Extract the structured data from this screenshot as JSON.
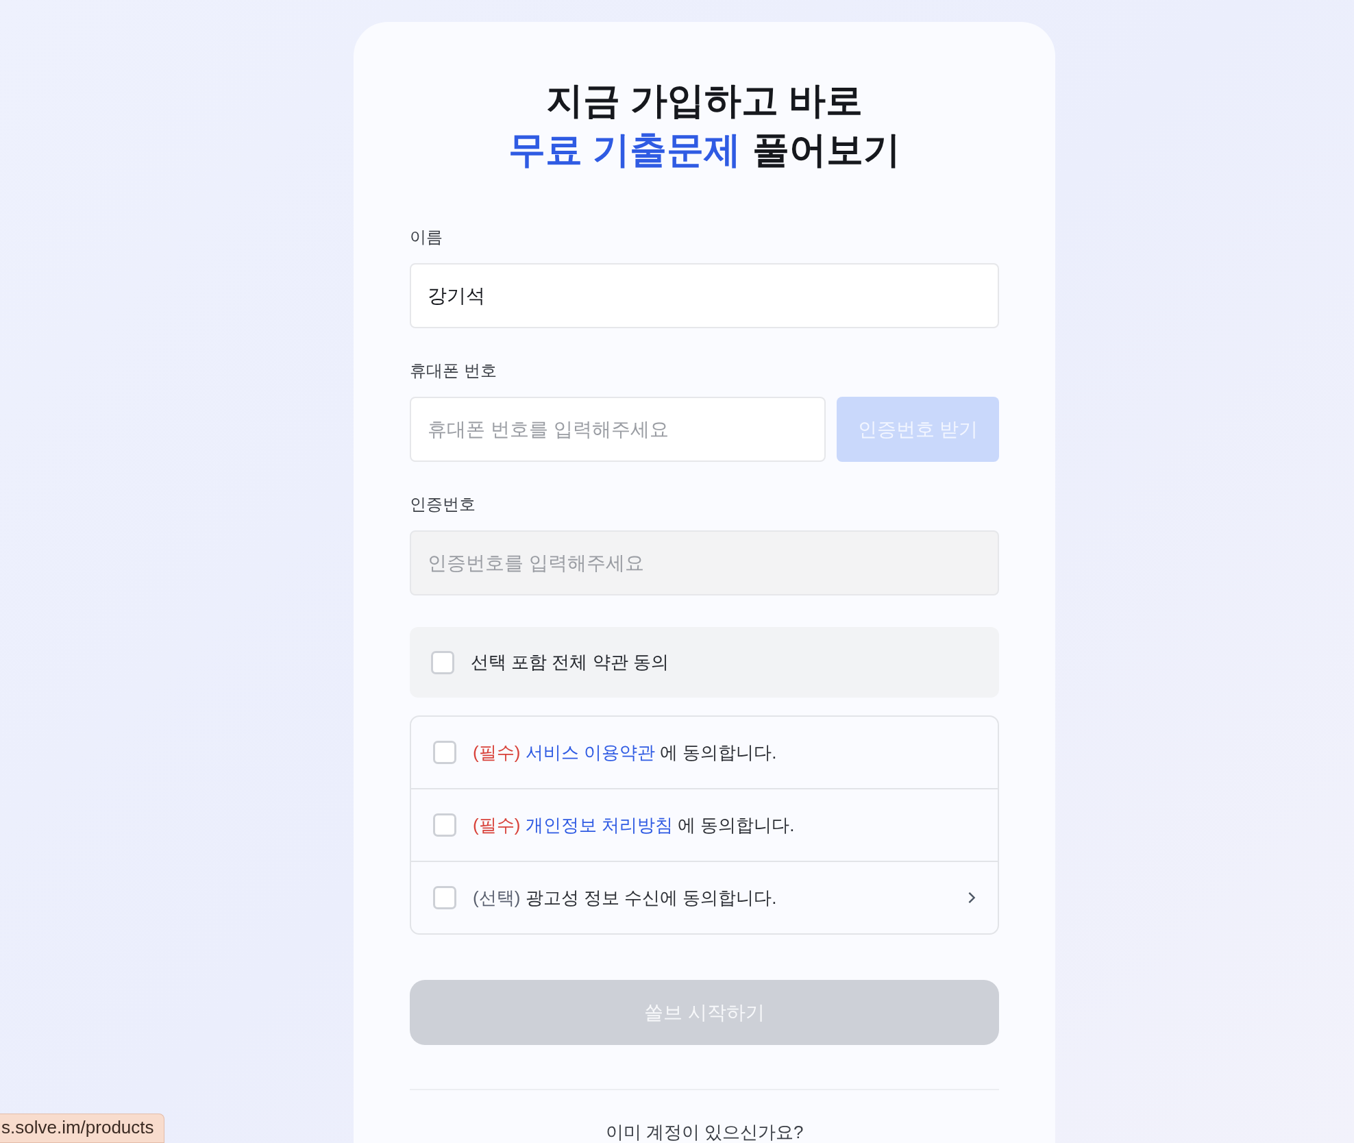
{
  "title": {
    "lines": [
      [
        {
          "text": "지금 가입하고 바로",
          "emphasis": false
        }
      ],
      [
        {
          "text": "무료 기출문제",
          "emphasis": true
        },
        {
          "text": "풀어보기",
          "emphasis": false
        }
      ]
    ]
  },
  "fields": [
    {
      "label": "이름",
      "value": "강기석",
      "disabled": false
    },
    {
      "label": "휴대폰 번호",
      "placeholder": "휴대폰 번호를 입력해주세요",
      "disabled": false,
      "button": {
        "label": "인증번호 받기",
        "disabled": true
      }
    },
    {
      "label": "인증번호",
      "placeholder": "인증번호를 입력해주세요",
      "disabled": true
    }
  ],
  "agree_all": {
    "label": "선택 포함 전체 약관 동의",
    "checked": false
  },
  "agreements": [
    {
      "tag": "(필수)",
      "required": true,
      "link": "서비스 이용약관",
      "text": "에 동의합니다.",
      "checked": false,
      "chevron": false
    },
    {
      "tag": "(필수)",
      "required": true,
      "link": "개인정보 처리방침",
      "text": "에 동의합니다.",
      "checked": false,
      "chevron": false
    },
    {
      "tag": "(선택)",
      "required": false,
      "text": "광고성 정보 수신에 동의합니다.",
      "checked": false,
      "chevron": true
    }
  ],
  "submit": {
    "label": "쏠브 시작하기",
    "disabled": true
  },
  "login_prompt": "이미 계정이 있으신가요?",
  "status_link": "s.solve.im/products"
}
